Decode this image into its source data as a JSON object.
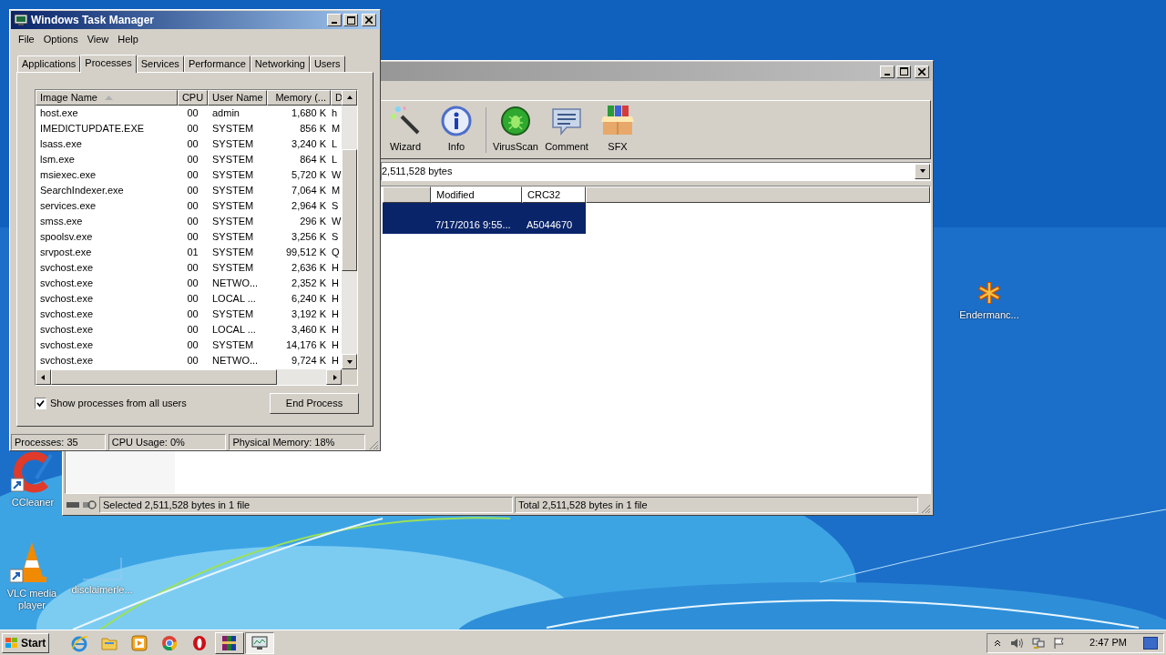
{
  "task_manager": {
    "title": "Windows Task Manager",
    "menu": [
      "File",
      "Options",
      "View",
      "Help"
    ],
    "tabs": [
      {
        "label": "Applications",
        "selected": false
      },
      {
        "label": "Processes",
        "selected": true
      },
      {
        "label": "Services",
        "selected": false
      },
      {
        "label": "Performance",
        "selected": false
      },
      {
        "label": "Networking",
        "selected": false
      },
      {
        "label": "Users",
        "selected": false
      }
    ],
    "columns": [
      "Image Name",
      "CPU",
      "User Name",
      "Memory (...",
      "D"
    ],
    "rows": [
      [
        "host.exe",
        "00",
        "admin",
        "1,680 K",
        "h"
      ],
      [
        "IMEDICTUPDATE.EXE",
        "00",
        "SYSTEM",
        "856 K",
        "M"
      ],
      [
        "lsass.exe",
        "00",
        "SYSTEM",
        "3,240 K",
        "L"
      ],
      [
        "lsm.exe",
        "00",
        "SYSTEM",
        "864 K",
        "L"
      ],
      [
        "msiexec.exe",
        "00",
        "SYSTEM",
        "5,720 K",
        "W"
      ],
      [
        "SearchIndexer.exe",
        "00",
        "SYSTEM",
        "7,064 K",
        "M"
      ],
      [
        "services.exe",
        "00",
        "SYSTEM",
        "2,964 K",
        "S"
      ],
      [
        "smss.exe",
        "00",
        "SYSTEM",
        "296 K",
        "W"
      ],
      [
        "spoolsv.exe",
        "00",
        "SYSTEM",
        "3,256 K",
        "S"
      ],
      [
        "srvpost.exe",
        "01",
        "SYSTEM",
        "99,512 K",
        "Q"
      ],
      [
        "svchost.exe",
        "00",
        "SYSTEM",
        "2,636 K",
        "H"
      ],
      [
        "svchost.exe",
        "00",
        "NETWO...",
        "2,352 K",
        "H"
      ],
      [
        "svchost.exe",
        "00",
        "LOCAL ...",
        "6,240 K",
        "H"
      ],
      [
        "svchost.exe",
        "00",
        "SYSTEM",
        "3,192 K",
        "H"
      ],
      [
        "svchost.exe",
        "00",
        "LOCAL ...",
        "3,460 K",
        "H"
      ],
      [
        "svchost.exe",
        "00",
        "SYSTEM",
        "14,176 K",
        "H"
      ],
      [
        "svchost.exe",
        "00",
        "NETWO...",
        "9,724 K",
        "H"
      ]
    ],
    "show_all_users": {
      "label": "Show processes from all users",
      "checked": true
    },
    "end_process": "End Process",
    "status": [
      "Processes: 35",
      "CPU Usage: 0%",
      "Physical Memory: 18%"
    ]
  },
  "archiver": {
    "toolbar": [
      {
        "label": "Wizard",
        "kind": "wand"
      },
      {
        "label": "Info",
        "kind": "info"
      },
      {
        "kind": "separator"
      },
      {
        "label": "VirusScan",
        "kind": "scan"
      },
      {
        "label": "Comment",
        "kind": "comment"
      },
      {
        "label": "SFX",
        "kind": "box"
      }
    ],
    "address": "2,511,528 bytes",
    "columns": [
      "Modified",
      "CRC32"
    ],
    "rows": [
      {
        "modified": "7/17/2016 9:55...",
        "crc": "A5044670",
        "selected": true
      }
    ],
    "status": [
      "Selected 2,511,528 bytes in 1 file",
      "Total 2,511,528 bytes in 1 file"
    ]
  },
  "desktop_icons": [
    {
      "label": "CCleaner",
      "kind": "ccleaner"
    },
    {
      "label": "VLC media player",
      "kind": "vlc"
    },
    {
      "label": "disclaimerle...",
      "kind": "file"
    },
    {
      "label": "Endermanc...",
      "kind": "star"
    }
  ],
  "taskbar": {
    "start": "Start",
    "apps": [
      {
        "kind": "ie",
        "selected": false
      },
      {
        "kind": "folder",
        "selected": false
      },
      {
        "kind": "media",
        "selected": false
      },
      {
        "kind": "chrome",
        "selected": false
      },
      {
        "kind": "opera",
        "selected": false
      },
      {
        "kind": "rar",
        "selected": false
      },
      {
        "kind": "taskmgr",
        "selected": true
      }
    ],
    "time": "2:47 PM"
  }
}
